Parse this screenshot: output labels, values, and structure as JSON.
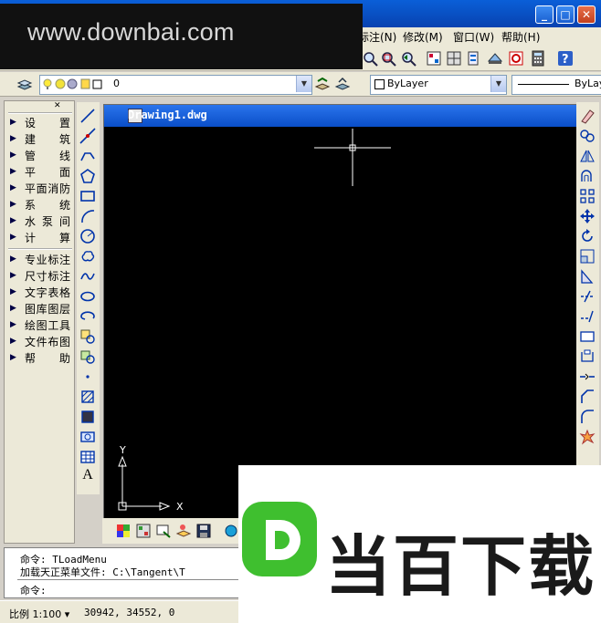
{
  "watermark": {
    "text": "www.downbai.com"
  },
  "window": {
    "buttons": {
      "minimize": "_",
      "maximize": "□",
      "close": "✕"
    }
  },
  "menubar": {
    "items": [
      {
        "id": "dim",
        "label": "标注(N)"
      },
      {
        "id": "modify",
        "label": "修改(M)"
      },
      {
        "id": "window",
        "label": "窗口(W)"
      },
      {
        "id": "help",
        "label": "帮助(H)"
      }
    ]
  },
  "layer_combo": {
    "value": "0"
  },
  "color_combo": {
    "value": "ByLayer"
  },
  "linetype_combo": {
    "value": "ByLay"
  },
  "left_panel": {
    "group1": [
      {
        "label": "设 置"
      },
      {
        "label": "建 筑"
      },
      {
        "label": "管 线"
      },
      {
        "label": "平 面"
      },
      {
        "label": "平面消防"
      },
      {
        "label": "系 统"
      },
      {
        "label": "水 泵 间"
      },
      {
        "label": "计 算"
      }
    ],
    "group2": [
      {
        "label": "专业标注"
      },
      {
        "label": "尺寸标注"
      },
      {
        "label": "文字表格"
      },
      {
        "label": "图库图层"
      },
      {
        "label": "绘图工具"
      },
      {
        "label": "文件布图"
      },
      {
        "label": "帮 助"
      }
    ],
    "close_glyph": "✕"
  },
  "drawing": {
    "title": "Drawing1.dwg",
    "ucs": {
      "x_label": "X",
      "y_label": "Y"
    }
  },
  "draw_toolbar": {
    "text_tool_glyph": "A"
  },
  "command_window": {
    "lines": [
      "命令: TLoadMenu",
      "加载天正菜单文件: C:\\Tangent\\T",
      "命令:"
    ]
  },
  "status": {
    "scale": "比例 1:100 ▾",
    "coordinates": "30942, 34552, 0"
  },
  "logo": {
    "text": "当百下载",
    "letter": "D"
  },
  "colors": {
    "titlebar": "#0a5fd8",
    "canvas": "#000000",
    "logo_green": "#3fbf2f",
    "panel_bg": "#ece9d8"
  }
}
